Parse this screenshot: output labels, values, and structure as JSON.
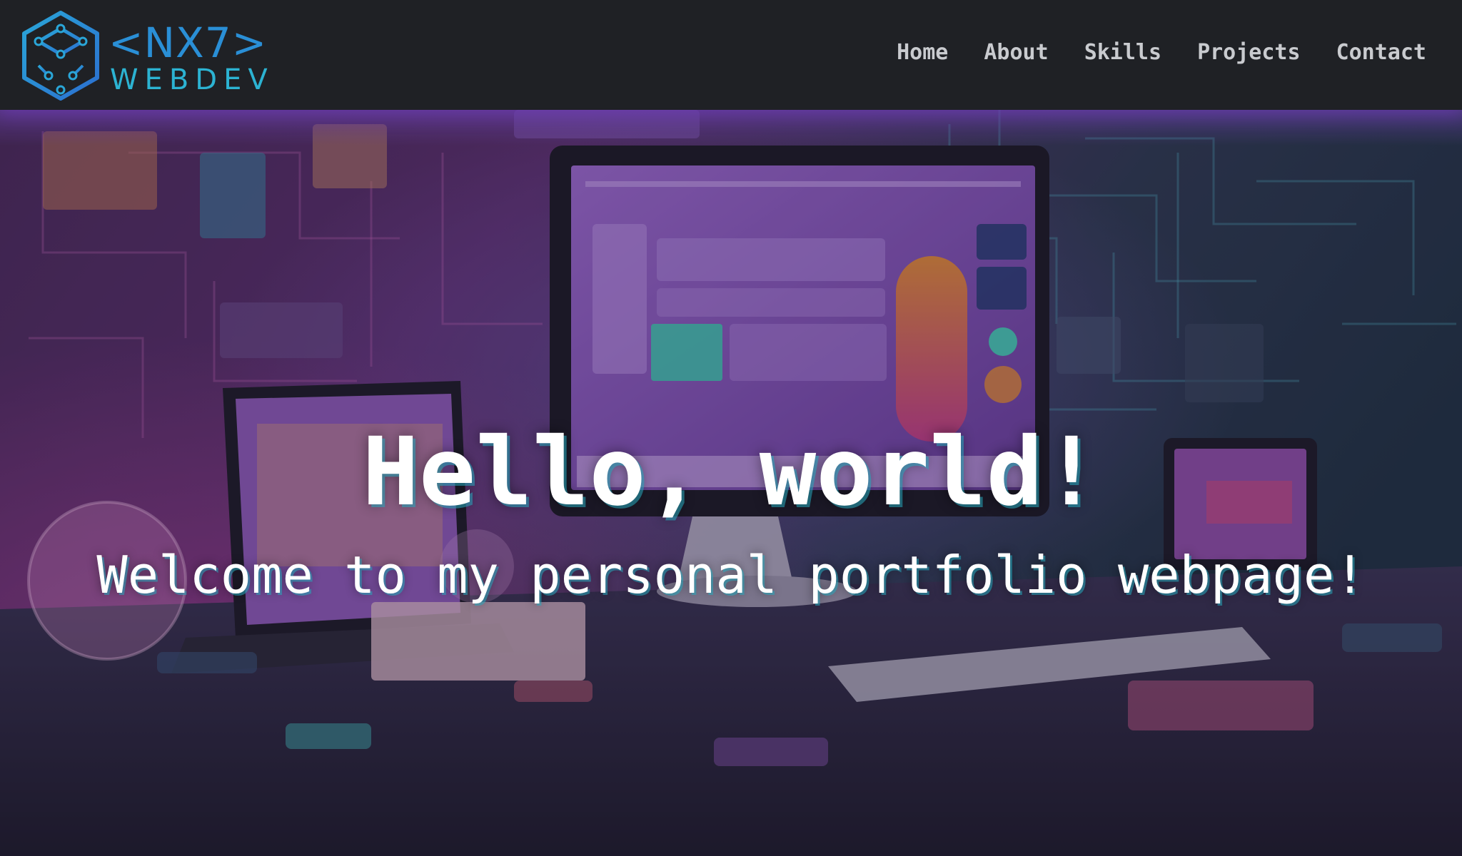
{
  "header": {
    "logo": {
      "top_text": "<NX7>",
      "bottom_text": "WEBDEV",
      "icon": "cube-network-icon"
    },
    "nav": [
      {
        "label": "Home"
      },
      {
        "label": "About"
      },
      {
        "label": "Skills"
      },
      {
        "label": "Projects"
      },
      {
        "label": "Contact"
      }
    ]
  },
  "hero": {
    "title": "Hello, world!",
    "subtitle": "Welcome to my personal portfolio webpage!",
    "background": "hero-desk-illustration"
  },
  "colors": {
    "header_bg": "#1f2125",
    "nav_text": "#c9cbcf",
    "logo_blue": "#2a8fd6",
    "logo_cyan": "#2cb3d2",
    "hero_text": "#ffffff",
    "accent_purple": "#8a4fd0",
    "accent_teal": "#2fb5b5"
  }
}
